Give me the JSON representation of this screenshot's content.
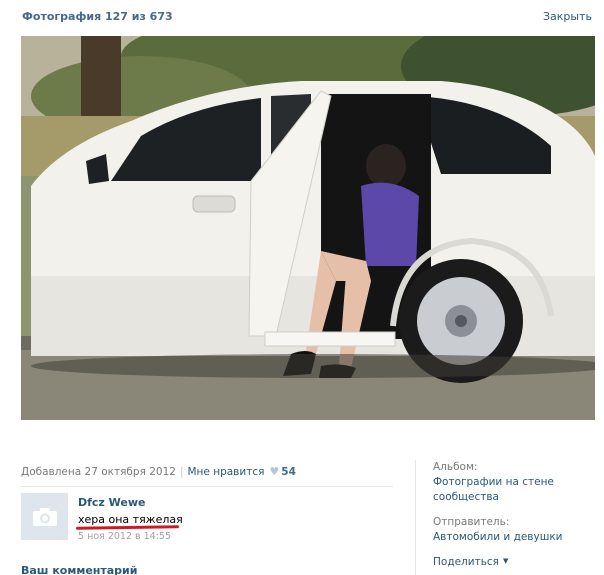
{
  "header": {
    "title": "Фотография 127 из 673",
    "close_label": "Закрыть"
  },
  "meta": {
    "added": "Добавлена 27 октября 2012",
    "separator": "|",
    "likes_label": "Мне нравится",
    "likes_count": "54",
    "heart_icon": "heart-icon"
  },
  "comment": {
    "author": "Dfcz Wewe",
    "text": "хера она тяжелая",
    "date": "5 ноя 2012 в 14:55",
    "avatar_icon": "camera-icon"
  },
  "your_comment_label": "Ваш комментарий",
  "sidebar": {
    "album_label": "Альбом:",
    "album_value": "Фотографии на стене сообщества",
    "sender_label": "Отправитель:",
    "sender_value": "Автомобили и девушки",
    "share_label": "Поделиться"
  },
  "colors": {
    "link": "#2b587a",
    "title": "#45688e",
    "muted": "#7a7a7a",
    "underline": "#c81d25"
  }
}
